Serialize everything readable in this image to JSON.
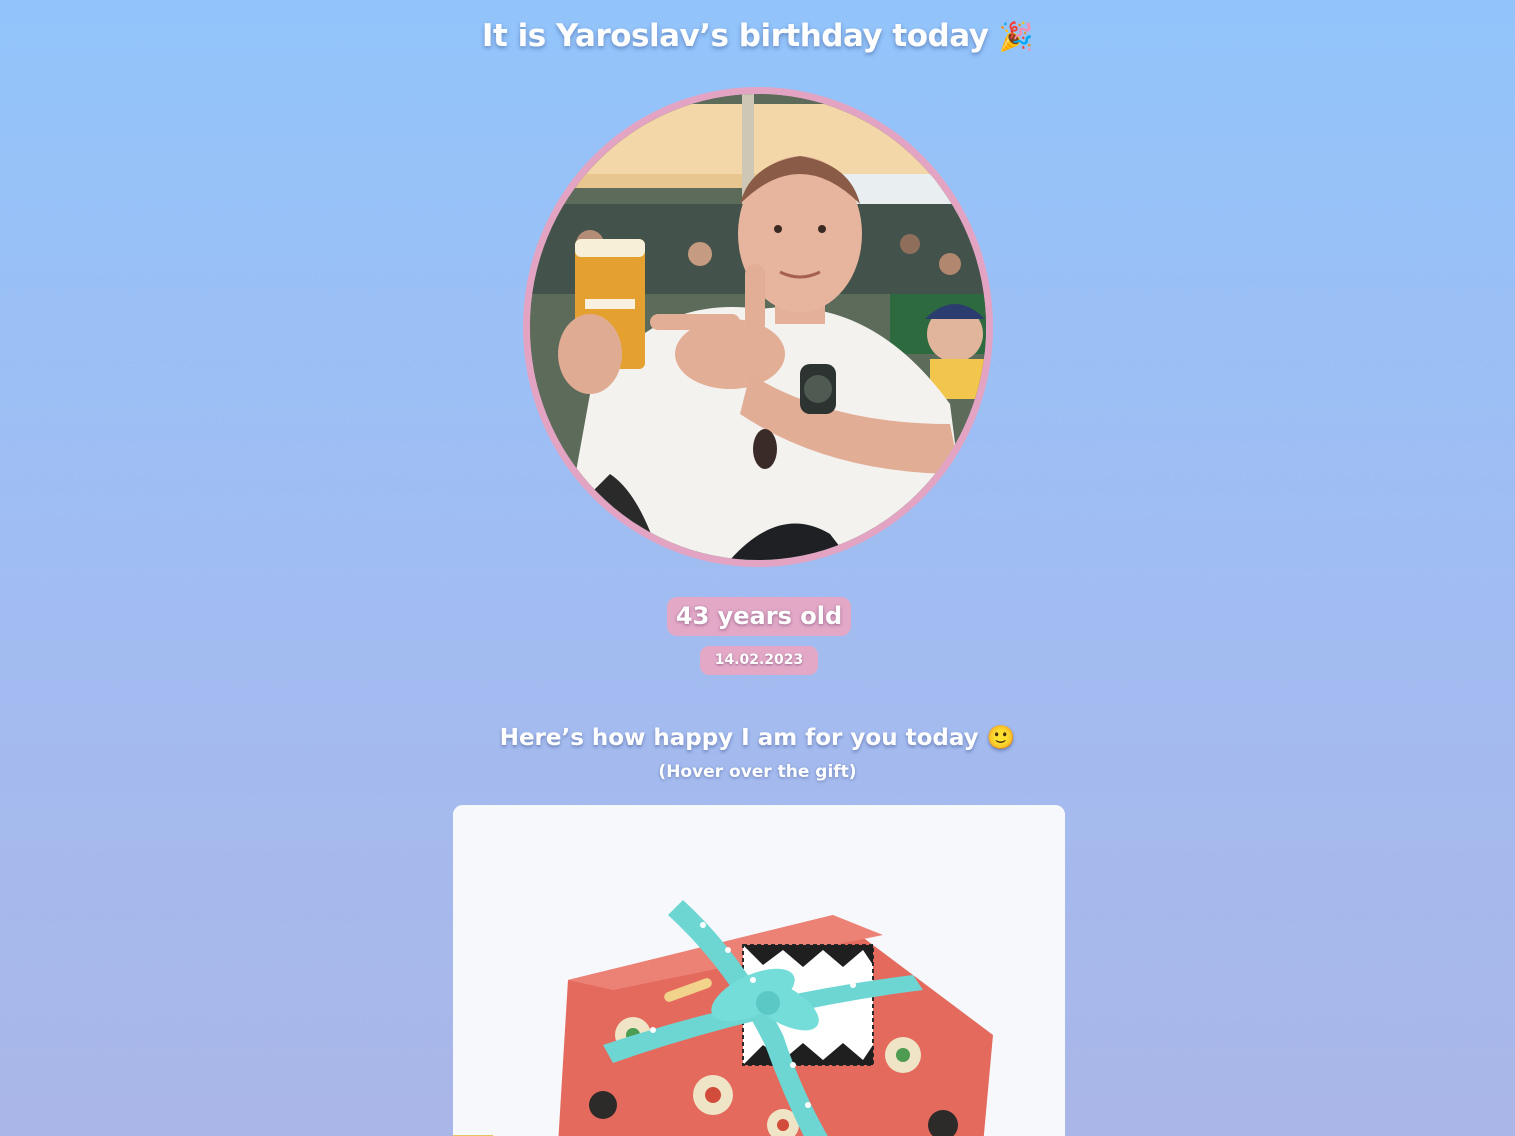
{
  "header": {
    "title": "It is Yaroslav’s birthday today",
    "title_emoji": "🎉"
  },
  "profile": {
    "photo_icon": "profile-photo",
    "age_label": "43 years old",
    "date": "14.02.2023"
  },
  "gift_section": {
    "heading": "Here’s how happy I am for you today",
    "heading_emoji": "🙂",
    "hint": "(Hover over the gift)",
    "gift_icon": "gift-box-image"
  },
  "colors": {
    "background_top": "#92c4fb",
    "background_bottom": "#aab6e7",
    "accent_pink": "#e2a8c6",
    "text": "#ffffff"
  }
}
